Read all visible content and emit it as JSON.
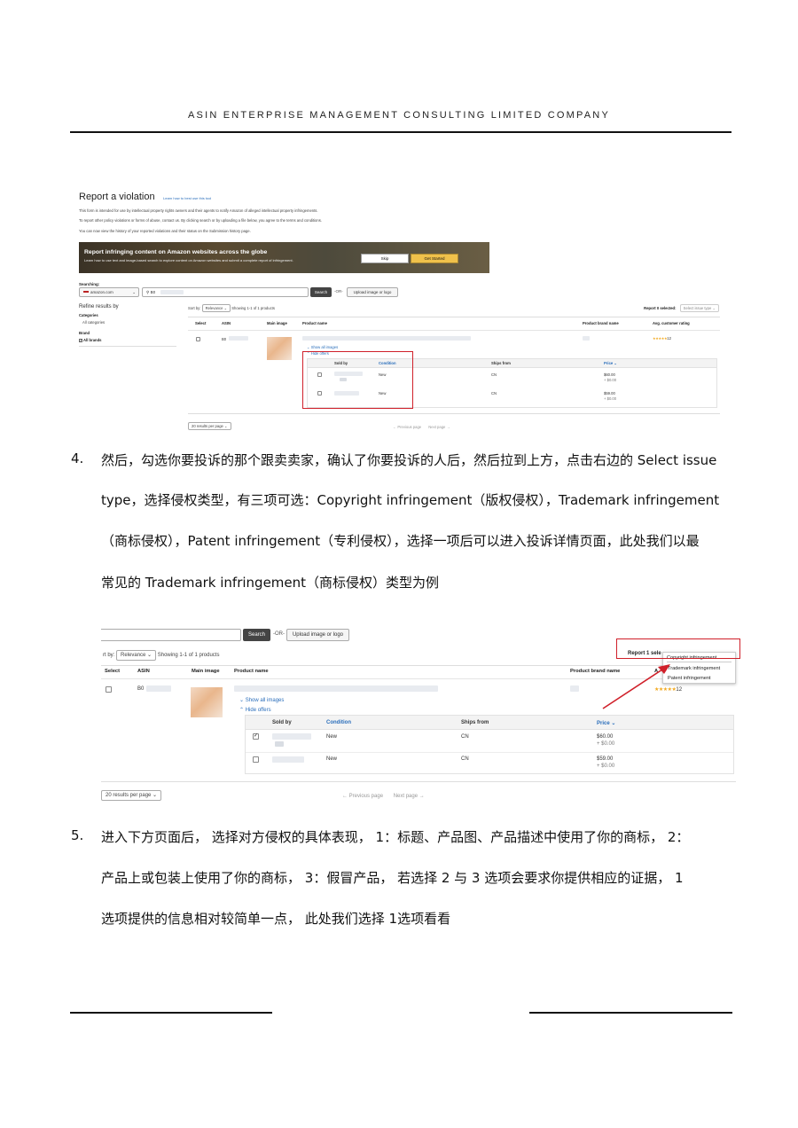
{
  "header": {
    "company": "ASIN ENTERPRISE MANAGEMENT CONSULTING LIMITED COMPANY"
  },
  "screenshot1": {
    "title": "Report a violation",
    "help_link": "Learn how to best use this tool",
    "intro": [
      "This form is intended for use by intellectual property rights owners and their agents to notify Amazon of alleged intellectual property infringements.",
      "To report other policy violations or forms of abuse, contact us. By clicking search or by uploading a file below, you agree to the terms and conditions.",
      "You can now view the history of your reported violations and their status on the Submission history page."
    ],
    "banner": {
      "title": "Report infringing content on Amazon websites across the globe",
      "subtitle": "Learn how to use text and image-based search to explore content on Amazon websites and submit a complete report of infringement.",
      "skip_label": "Skip",
      "start_label": "Get Started"
    },
    "searching_label": "Searching:",
    "marketplace": "amazon.com",
    "query": "B0",
    "search_label": "Search",
    "or_label": "-OR-",
    "upload_label": "Upload image or logo",
    "sidebar": {
      "title": "Refine results by",
      "categories_label": "Categories",
      "categories_value": "All categories",
      "brand_label": "Brand",
      "brand_value": "All brands"
    },
    "sort_label": "Sort by:",
    "sort_value": "Relevance",
    "showing": "Showing 1-1 of 1 products",
    "report_selected": "Report 0 selected:",
    "issue_placeholder": "Select issue type",
    "columns": [
      "Select",
      "ASIN",
      "Main image",
      "Product name",
      "Product brand name",
      "Avg. customer rating"
    ],
    "asin": "B0",
    "rating_stars": "★★★★★",
    "rating_count": "12",
    "show_all_images": "Show all images",
    "hide_offers": "Hide offers",
    "offer_columns": [
      "Sold by",
      "Condition",
      "Ships from",
      "Price"
    ],
    "offers": [
      {
        "condition": "New",
        "ships_from": "CN",
        "price": "$60.00",
        "shipping": "+ $0.00"
      },
      {
        "condition": "New",
        "ships_from": "CN",
        "price": "$59.00",
        "shipping": "+ $0.00"
      }
    ],
    "per_page": "20 results per page",
    "prev": "← Previous page",
    "next": "Next page →"
  },
  "step4": {
    "number": "4.",
    "lines": [
      "然后，勾选你要投诉的那个跟卖卖家，确认了你要投诉的人后，然后拉到上方，点击右边的 Select issue",
      "type，选择侵权类型，有三项可选：Copyright infringement（版权侵权），Trademark infringement",
      "（商标侵权），Patent infringement（专利侵权），选择一项后可以进入投诉详情页面，此处我们以最",
      "常见的 Trademark infringement（商标侵权）类型为例"
    ]
  },
  "screenshot2": {
    "search_label": "Search",
    "or_label": "-OR-",
    "upload_label": "Upload image or logo",
    "sort_label": "rt by:",
    "sort_value": "Relevance",
    "showing": "Showing 1-1 of 1 products",
    "report_selected": "Report 1 sele",
    "columns": [
      "Select",
      "ASIN",
      "Main image",
      "Product name",
      "Product brand name",
      "A"
    ],
    "asin": "B0",
    "rating_stars": "★★★★★",
    "rating_count": "12",
    "show_all_images": "Show all images",
    "hide_offers": "Hide offers",
    "offer_columns": [
      "Sold by",
      "Condition",
      "Ships from",
      "Price"
    ],
    "offers": [
      {
        "condition": "New",
        "ships_from": "CN",
        "price": "$60.00",
        "shipping": "+ $0.00"
      },
      {
        "condition": "New",
        "ships_from": "CN",
        "price": "$59.00",
        "shipping": "+ $0.00"
      }
    ],
    "issue_options": [
      "Copyright infringement",
      "Trademark infringement",
      "Patent infringement"
    ],
    "per_page": "20 results per page",
    "prev": "← Previous page",
    "next": "Next page →"
  },
  "step5": {
    "number": "5.",
    "lines": [
      "进入下方页面后， 选择对方侵权的具体表现， 1：标题、产品图、产品描述中使用了你的商标， 2：",
      "产品上或包装上使用了你的商标， 3：假冒产品，  若选择 2 与 3 选项会要求你提供相应的证据， 1",
      "选项提供的信息相对较简单一点， 此处我们选择 1选项看看"
    ]
  },
  "colors": {
    "accent_link": "#2a6ebb",
    "highlight_red": "#d0202a",
    "button_yellow": "#f0c14b"
  }
}
